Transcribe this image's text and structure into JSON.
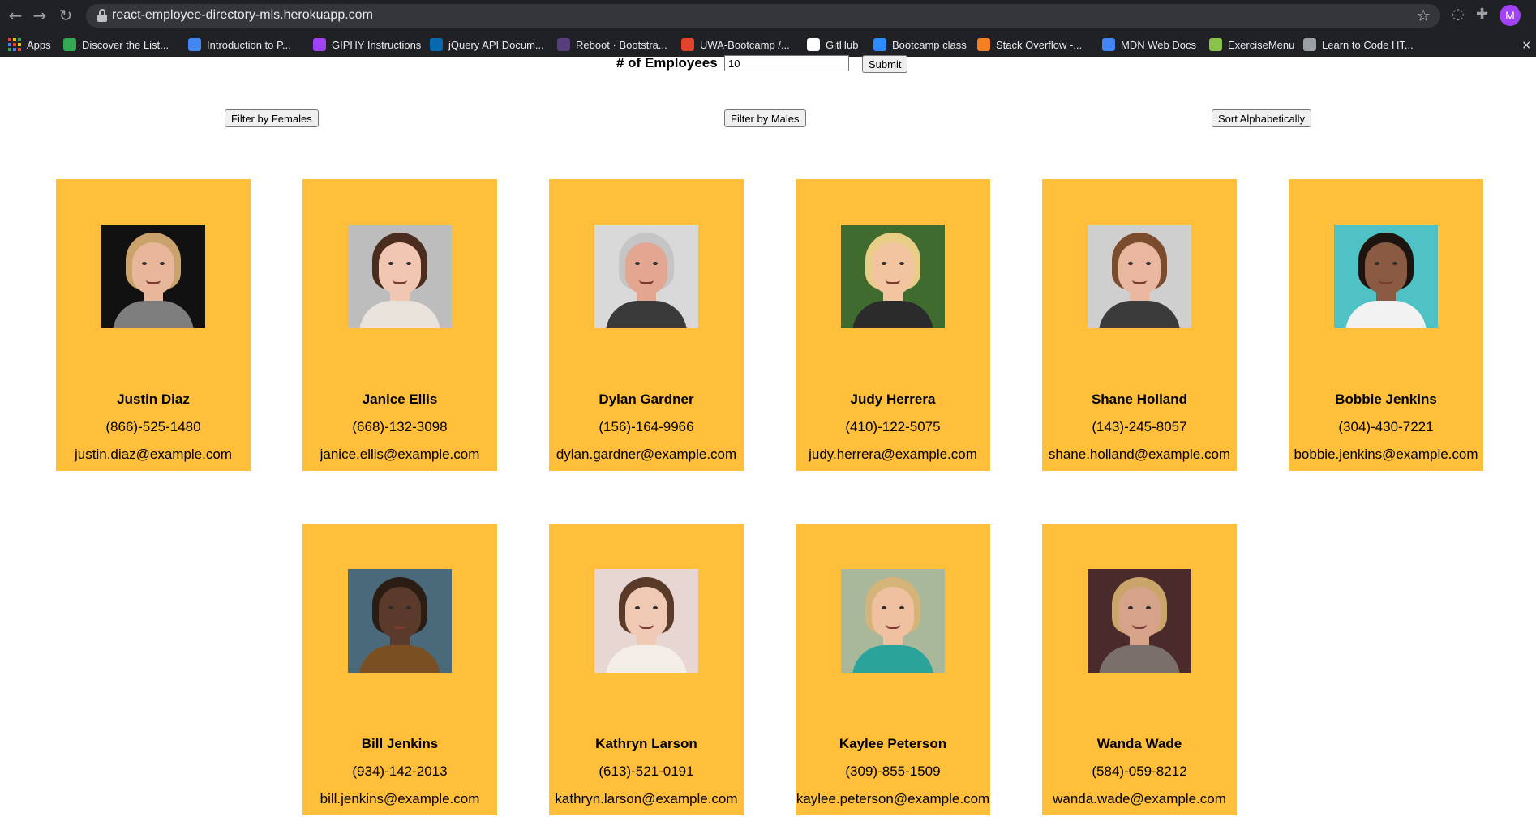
{
  "browser": {
    "url": "react-employee-directory-mls.herokuapp.com",
    "avatar_letter": "M",
    "bookmarks": [
      {
        "label": "Apps",
        "icon": "apps-grid-icon",
        "color": "#ea4335"
      },
      {
        "label": "Discover the List...",
        "icon": "list-icon",
        "color": "#34a853"
      },
      {
        "label": "Introduction to P...",
        "icon": "graduation-icon",
        "color": "#4285f4"
      },
      {
        "label": "GIPHY Instructions",
        "icon": "doc-icon",
        "color": "#a142f4"
      },
      {
        "label": "jQuery API Docum...",
        "icon": "jquery-icon",
        "color": "#0769ad"
      },
      {
        "label": "Reboot · Bootstra...",
        "icon": "bootstrap-icon",
        "color": "#563d7c"
      },
      {
        "label": "UWA-Bootcamp /...",
        "icon": "gitlab-icon",
        "color": "#e24329"
      },
      {
        "label": "GitHub",
        "icon": "github-icon",
        "color": "#ffffff"
      },
      {
        "label": "Bootcamp class",
        "icon": "zoom-icon",
        "color": "#2d8cff"
      },
      {
        "label": "Stack Overflow -...",
        "icon": "stackoverflow-icon",
        "color": "#f48024"
      },
      {
        "label": "MDN Web Docs",
        "icon": "graduation-icon",
        "color": "#4285f4"
      },
      {
        "label": "ExerciseMenu",
        "icon": "sprout-icon",
        "color": "#8bc34a"
      },
      {
        "label": "Learn to Code HT...",
        "icon": "code-icon",
        "color": "#9aa0a6"
      }
    ]
  },
  "controls": {
    "employees_label": "# of Employees",
    "employees_value": "10",
    "submit_label": "Submit",
    "filter_females_label": "Filter by Females",
    "filter_males_label": "Filter by Males",
    "sort_label": "Sort Alphabetically"
  },
  "colors": {
    "card_background": "#ffbf3a"
  },
  "employees": [
    {
      "name": "Justin Diaz",
      "phone": "(866)-525-1480",
      "email": "justin.diaz@example.com",
      "bg": "#111111",
      "hair": "#c9a36b",
      "skin": "#e8b69a",
      "shirt": "#7d7d7d"
    },
    {
      "name": "Janice Ellis",
      "phone": "(668)-132-3098",
      "email": "janice.ellis@example.com",
      "bg": "#bdbdbd",
      "hair": "#4a2d1f",
      "skin": "#f1c7b3",
      "shirt": "#e9e3dc"
    },
    {
      "name": "Dylan Gardner",
      "phone": "(156)-164-9966",
      "email": "dylan.gardner@example.com",
      "bg": "#d9d9d9",
      "hair": "#c5c5c5",
      "skin": "#e3a690",
      "shirt": "#3a3a3a"
    },
    {
      "name": "Judy Herrera",
      "phone": "(410)-122-5075",
      "email": "judy.herrera@example.com",
      "bg": "#3f6b2e",
      "hair": "#e8cd87",
      "skin": "#f2c4a0",
      "shirt": "#2b2b2b"
    },
    {
      "name": "Shane Holland",
      "phone": "(143)-245-8057",
      "email": "shane.holland@example.com",
      "bg": "#cfcfcf",
      "hair": "#7a4b2c",
      "skin": "#e9b7a0",
      "shirt": "#3b3b3b"
    },
    {
      "name": "Bobbie Jenkins",
      "phone": "(304)-430-7221",
      "email": "bobbie.jenkins@example.com",
      "bg": "#4fc2c6",
      "hair": "#1d1410",
      "skin": "#8a5a43",
      "shirt": "#f2f2f2"
    },
    {
      "name": "Bill Jenkins",
      "phone": "(934)-142-2013",
      "email": "bill.jenkins@example.com",
      "bg": "#4a6a7c",
      "hair": "#2b1c14",
      "skin": "#5a3a2a",
      "shirt": "#7a4f22"
    },
    {
      "name": "Kathryn Larson",
      "phone": "(613)-521-0191",
      "email": "kathryn.larson@example.com",
      "bg": "#e7d6d2",
      "hair": "#5a3b2a",
      "skin": "#f0c9b5",
      "shirt": "#f4ede8"
    },
    {
      "name": "Kaylee Peterson",
      "phone": "(309)-855-1509",
      "email": "kaylee.peterson@example.com",
      "bg": "#a9b79a",
      "hair": "#d5b47a",
      "skin": "#efc1a1",
      "shirt": "#2aa39a"
    },
    {
      "name": "Wanda Wade",
      "phone": "(584)-059-8212",
      "email": "wanda.wade@example.com",
      "bg": "#4a2a2a",
      "hair": "#c9a56a",
      "skin": "#d6a28a",
      "shirt": "#7a6f6a"
    }
  ]
}
